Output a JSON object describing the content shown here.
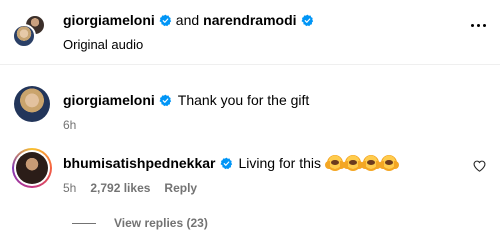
{
  "header": {
    "user1": "giorgiameloni",
    "connector": "and",
    "user2": "narendramodi",
    "subtitle": "Original audio"
  },
  "caption": {
    "username": "giorgiameloni",
    "text": "Thank you for the gift",
    "time": "6h"
  },
  "comment": {
    "username": "bhumisatishpednekkar",
    "text": "Living for this",
    "emojis": [
      "raising-hands-emoji",
      "raising-hands-emoji",
      "raising-hands-emoji",
      "raising-hands-emoji"
    ],
    "time": "5h",
    "likes": "2,792 likes",
    "reply_label": "Reply"
  },
  "view_replies": "View replies (23)",
  "colors": {
    "verified": "#0095f6",
    "secondary_text": "#737373"
  }
}
